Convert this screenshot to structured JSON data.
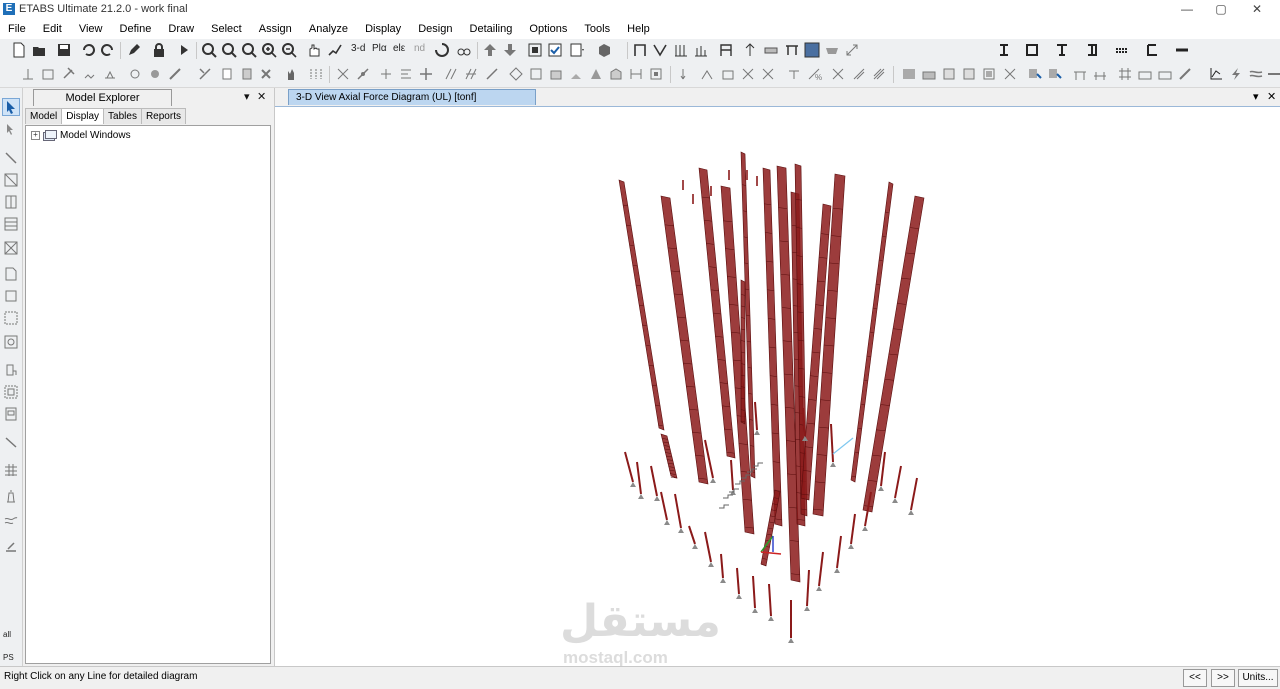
{
  "window": {
    "title": "ETABS Ultimate 21.2.0 - work final",
    "app_icon_letter": "E",
    "controls": {
      "minimize": "—",
      "maximize": "▢",
      "close": "✕"
    }
  },
  "menu": [
    "File",
    "Edit",
    "View",
    "Define",
    "Draw",
    "Select",
    "Assign",
    "Analyze",
    "Display",
    "Design",
    "Detailing",
    "Options",
    "Tools",
    "Help"
  ],
  "toolbar": {
    "view_3d_label": "3-d",
    "plan_label": "Plα",
    "elev_label": "elε",
    "nd_label": "nd"
  },
  "left_tools": {
    "all_label": "all",
    "ps_label": "PS"
  },
  "explorer": {
    "title": "Model Explorer",
    "pin": "▾",
    "close": "✕",
    "tabs": [
      "Model",
      "Display",
      "Tables",
      "Reports"
    ],
    "active_tab": "Display",
    "tree": [
      {
        "expander": "+",
        "label": "Model Windows"
      }
    ]
  },
  "view": {
    "tab_title": "3-D View   Axial Force Diagram   (UL)  [tonf]",
    "pin": "▾",
    "close": "✕",
    "diagram_color": "#8b1a1a",
    "frame_color": "#8a8a8a"
  },
  "status": {
    "message": "Right Click on any Line for detailed diagram",
    "prev": "<<",
    "next": ">>",
    "units": "Units..."
  },
  "watermark": {
    "arabic": "مستقل",
    "latin": "mostaql.com"
  }
}
